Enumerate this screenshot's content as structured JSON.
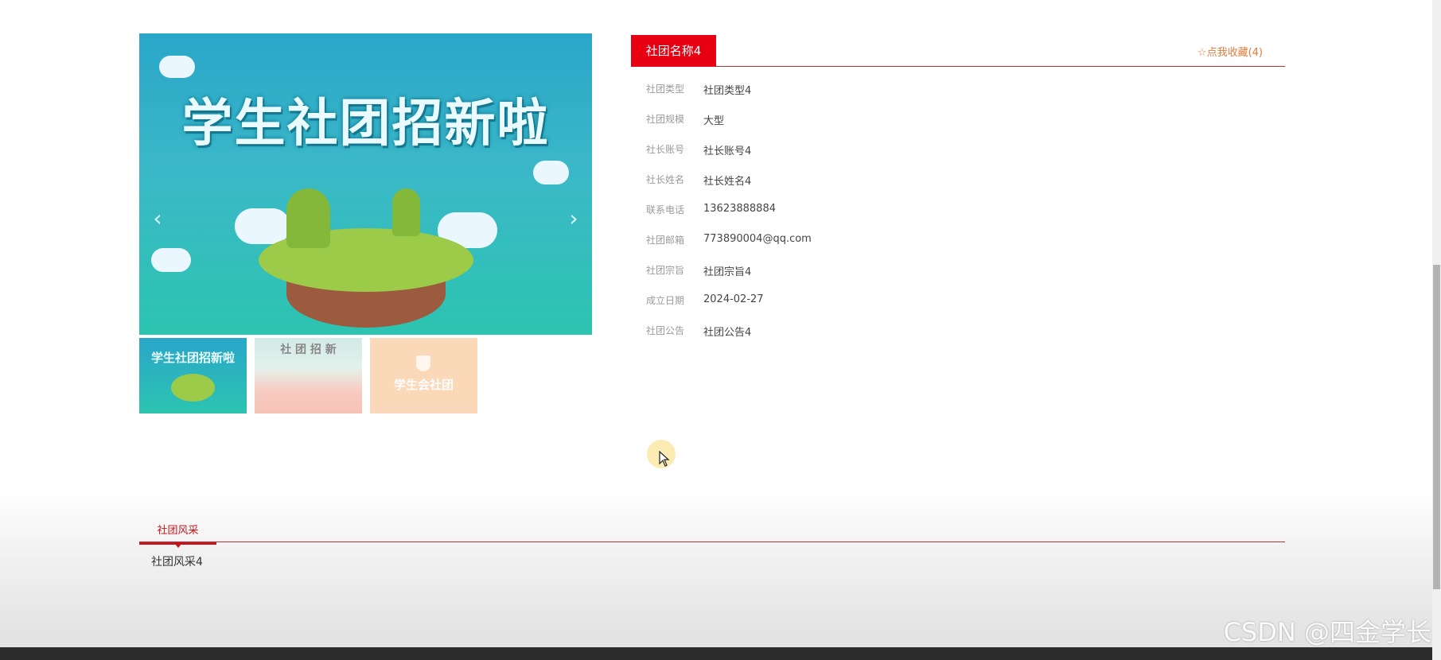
{
  "carousel": {
    "headline": "学生社团招新啦",
    "prev_icon": "chevron-left-icon",
    "next_icon": "chevron-right-icon",
    "thumbnails": [
      {
        "text": "学生社团招新啦"
      },
      {
        "text": "社 团 招 新"
      },
      {
        "text": "学生会社团"
      }
    ]
  },
  "detail": {
    "title": "社团名称4",
    "favorite_label": "☆点我收藏(4)",
    "fields": [
      {
        "label": "社团类型",
        "value": "社团类型4"
      },
      {
        "label": "社团规模",
        "value": "大型"
      },
      {
        "label": "社长账号",
        "value": "社长账号4"
      },
      {
        "label": "社长姓名",
        "value": "社长姓名4"
      },
      {
        "label": "联系电话",
        "value": "13623888884"
      },
      {
        "label": "社团邮箱",
        "value": "773890004@qq.com"
      },
      {
        "label": "社团宗旨",
        "value": "社团宗旨4"
      },
      {
        "label": "成立日期",
        "value": "2024-02-27"
      },
      {
        "label": "社团公告",
        "value": "社团公告4"
      }
    ]
  },
  "tabs": {
    "active_label": "社团风采",
    "content": "社团风采4"
  },
  "watermark": "CSDN @四金学长",
  "colors": {
    "accent": "#e60012",
    "tab_underline": "#c4161c",
    "link": "#e07a3a"
  }
}
